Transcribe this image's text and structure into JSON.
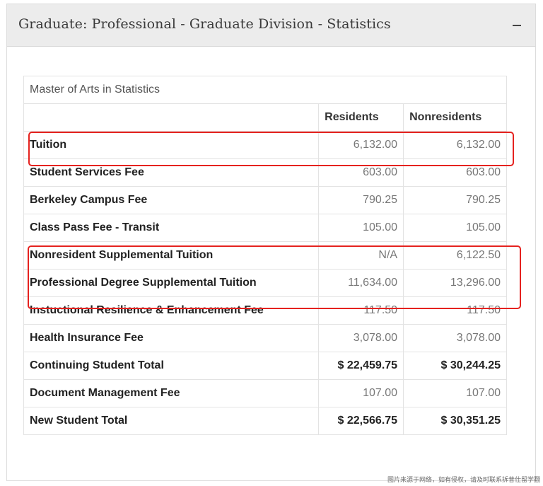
{
  "panel": {
    "title": "Graduate: Professional - Graduate Division - Statistics",
    "collapse_icon": "minus-icon"
  },
  "table": {
    "caption": "Master of Arts in Statistics",
    "columns": [
      "",
      "Residents",
      "Nonresidents"
    ],
    "rows": [
      {
        "label": "Tuition",
        "residents": "6,132.00",
        "nonresidents": "6,132.00"
      },
      {
        "label": "Student Services Fee",
        "residents": "603.00",
        "nonresidents": "603.00"
      },
      {
        "label": "Berkeley Campus Fee",
        "residents": "790.25",
        "nonresidents": "790.25"
      },
      {
        "label": "Class Pass Fee - Transit",
        "residents": "105.00",
        "nonresidents": "105.00"
      },
      {
        "label": "Nonresident Supplemental Tuition",
        "residents": "N/A",
        "nonresidents": "6,122.50"
      },
      {
        "label": "Professional Degree Supplemental Tuition",
        "residents": "11,634.00",
        "nonresidents": "13,296.00"
      },
      {
        "label": "Instuctional Resilience & Enhancement Fee",
        "residents": "117.50",
        "nonresidents": "117.50"
      },
      {
        "label": "Health Insurance Fee",
        "residents": "3,078.00",
        "nonresidents": "3,078.00"
      },
      {
        "label": "Continuing Student Total",
        "residents": "$ 22,459.75",
        "nonresidents": "$ 30,244.25"
      },
      {
        "label": "Document Management Fee",
        "residents": "107.00",
        "nonresidents": "107.00"
      },
      {
        "label": "New Student Total",
        "residents": "$ 22,566.75",
        "nonresidents": "$ 30,351.25"
      }
    ]
  },
  "highlight_color": "#e5221f",
  "watermark": "图片来源于网络，如有侵权，请及时联系拆昔仕留学翻"
}
